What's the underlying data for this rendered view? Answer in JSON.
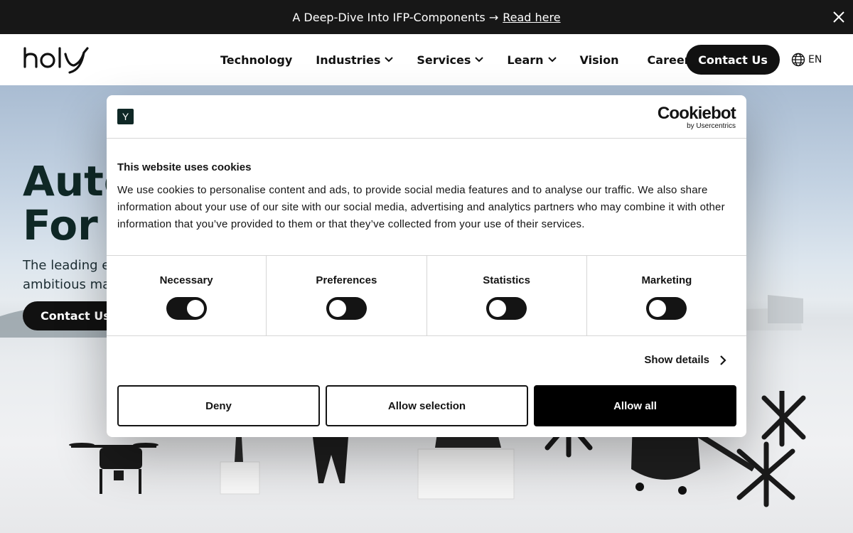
{
  "banner": {
    "text": "A Deep-Dive Into IFP-Components →",
    "link": "Read here"
  },
  "nav": {
    "logo": "holy",
    "items": [
      {
        "label": "Technology",
        "dropdown": false
      },
      {
        "label": "Industries",
        "dropdown": true
      },
      {
        "label": "Services",
        "dropdown": true
      },
      {
        "label": "Learn",
        "dropdown": true
      },
      {
        "label": "Vision",
        "dropdown": false
      },
      {
        "label": "Careers",
        "dropdown": false
      }
    ],
    "contact": "Contact Us",
    "language": "EN"
  },
  "hero": {
    "title": "Auto\nFor",
    "subtitle": "The leading e\nambitious ma",
    "contact": "Contact Us"
  },
  "cookie": {
    "brand": "Cookiebot",
    "brand_sub": "by Usercentrics",
    "title": "This website uses cookies",
    "text": "We use cookies to personalise content and ads, to provide social media features and to analyse our traffic. We also share information about your use of our site with our social media, advertising and analytics partners who may combine it with other information that you’ve provided to them or that they’ve collected from your use of their services.",
    "categories": [
      {
        "label": "Necessary",
        "enabled": true
      },
      {
        "label": "Preferences",
        "enabled": false
      },
      {
        "label": "Statistics",
        "enabled": false
      },
      {
        "label": "Marketing",
        "enabled": false
      }
    ],
    "show_details": "Show details",
    "buttons": {
      "deny": "Deny",
      "allow_selection": "Allow selection",
      "allow_all": "Allow all"
    }
  },
  "colors": {
    "brand_dark": "#0f2826",
    "banner_bg": "#171717",
    "button_dark": "#111111"
  }
}
